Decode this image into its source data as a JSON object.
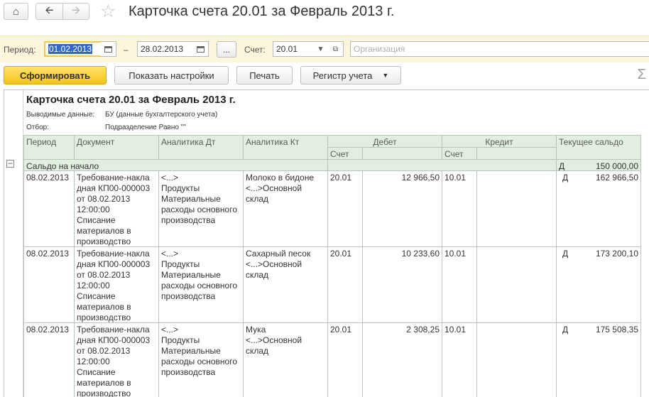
{
  "window": {
    "title": "Карточка счета 20.01 за Февраль 2013 г."
  },
  "icons": {
    "home": "home-icon",
    "back": "arrow-left-icon",
    "forward": "arrow-right-icon",
    "favorite": "star-icon",
    "calendar": "calendar-icon",
    "dropdown": "chevron-down-icon",
    "open": "open-icon",
    "sum": "sigma-icon"
  },
  "params": {
    "period_label": "Период:",
    "date_from": "01.02.2013",
    "dash": "–",
    "date_to": "28.02.2013",
    "dots": "...",
    "account_label": "Счет:",
    "account_value": "20.01",
    "org_placeholder": "Организация"
  },
  "toolbar": {
    "generate": "Сформировать",
    "show_settings": "Показать настройки",
    "print": "Печать",
    "register": "Регистр учета"
  },
  "report": {
    "title": "Карточка счета 20.01 за Февраль 2013 г.",
    "output_label": "Выводимые данные:",
    "output_value": "БУ (данные бухгалтерского учета)",
    "filter_label": "Отбор:",
    "filter_value": "Подразделение Равно \"\"",
    "headers": {
      "period": "Период",
      "document": "Документ",
      "analytics_dt": "Аналитика Дт",
      "analytics_kt": "Аналитика Кт",
      "debit": "Дебет",
      "credit": "Кредит",
      "balance": "Текущее сальдо",
      "account": "Счет"
    },
    "opening": {
      "label": "Сальдо на начало",
      "side": "Д",
      "amount": "150 000,00"
    },
    "rows": [
      {
        "date": "08.02.2013",
        "document": [
          "Требование-накла",
          "дная КП00-000003",
          "от 08.02.2013",
          "12:00:00",
          "Списание",
          "материалов в",
          "производство"
        ],
        "analytics_dt": [
          "<...>",
          "Продукты",
          "Материальные",
          "расходы основного",
          "производства"
        ],
        "analytics_kt": [
          "Молоко в бидоне",
          "<...>Основной",
          "склад"
        ],
        "debit_account": "20.01",
        "debit_amount": "12 966,50",
        "credit_account": "10.01",
        "balance_side": "Д",
        "balance_amount": "162 966,50"
      },
      {
        "date": "08.02.2013",
        "document": [
          "Требование-накла",
          "дная КП00-000003",
          "от 08.02.2013",
          "12:00:00",
          "Списание",
          "материалов в",
          "производство"
        ],
        "analytics_dt": [
          "<...>",
          "Продукты",
          "Материальные",
          "расходы основного",
          "производства"
        ],
        "analytics_kt": [
          "Сахарный песок",
          "<...>Основной",
          "склад"
        ],
        "debit_account": "20.01",
        "debit_amount": "10 233,60",
        "credit_account": "10.01",
        "balance_side": "Д",
        "balance_amount": "173 200,10"
      },
      {
        "date": "08.02.2013",
        "document": [
          "Требование-накла",
          "дная КП00-000003",
          "от 08.02.2013",
          "12:00:00",
          "Списание",
          "материалов в",
          "производство"
        ],
        "analytics_dt": [
          "<...>",
          "Продукты",
          "Материальные",
          "расходы основного",
          "производства"
        ],
        "analytics_kt": [
          "Мука",
          "<...>Основной",
          "склад"
        ],
        "debit_account": "20.01",
        "debit_amount": "2 308,25",
        "credit_account": "10.01",
        "balance_side": "Д",
        "balance_amount": "175 508,35"
      }
    ]
  }
}
